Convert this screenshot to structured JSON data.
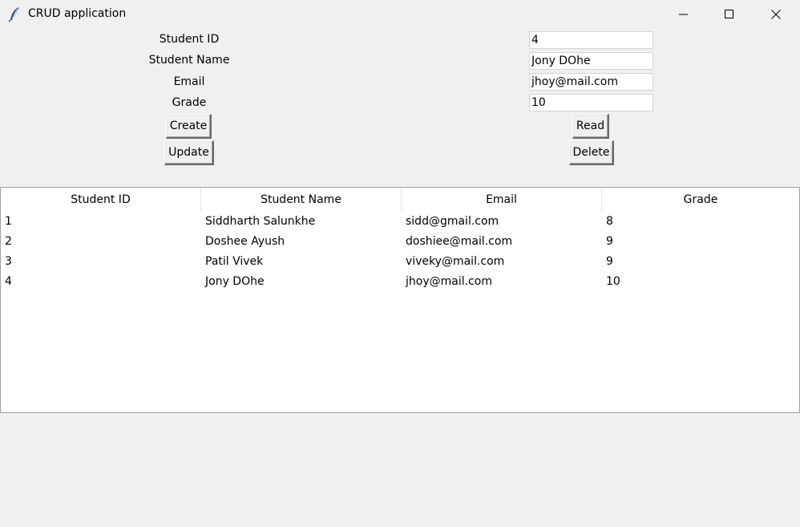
{
  "window": {
    "title": "CRUD application",
    "icon": "feather-icon"
  },
  "form": {
    "fields": [
      {
        "label": "Student ID",
        "value": "4"
      },
      {
        "label": "Student Name",
        "value": "Jony DOhe"
      },
      {
        "label": "Email",
        "value": "jhoy@mail.com"
      },
      {
        "label": "Grade",
        "value": "10"
      }
    ],
    "buttons": {
      "create": "Create",
      "update": "Update",
      "read": "Read",
      "delete": "Delete"
    }
  },
  "table": {
    "columns": [
      "Student ID",
      "Student Name",
      "Email",
      "Grade"
    ],
    "rows": [
      [
        "1",
        "Siddharth Salunkhe",
        "sidd@gmail.com",
        "8"
      ],
      [
        "2",
        "Doshee Ayush",
        "doshiee@mail.com",
        "9"
      ],
      [
        "3",
        "Patil Vivek",
        "viveky@mail.com",
        "9"
      ],
      [
        "4",
        "Jony DOhe",
        "jhoy@mail.com",
        "10"
      ]
    ]
  }
}
